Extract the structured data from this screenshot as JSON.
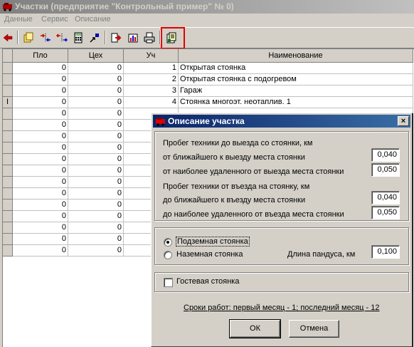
{
  "window": {
    "title": "Участки (предприятие \"Контрольный пример\" № 0)"
  },
  "menu": [
    "Данные",
    "Сервис",
    "Описание"
  ],
  "toolbar": {
    "buttons": [
      "back-arrow-icon",
      "copy-icon",
      "move-in-icon",
      "move-out-icon",
      "calculator-icon",
      "arrow-tool-icon",
      "export-icon",
      "chart-icon",
      "print-icon",
      "describe-icon"
    ]
  },
  "grid": {
    "columns": [
      "Пло",
      "Цех",
      "Уч",
      "Наименование"
    ],
    "rows": [
      [
        "0",
        "0",
        "1",
        "Открытая стоянка"
      ],
      [
        "0",
        "0",
        "2",
        "Открытая стоянка с подогревом"
      ],
      [
        "0",
        "0",
        "3",
        "Гараж"
      ],
      [
        "0",
        "0",
        "4",
        "Стоянка многоэт. неотаплив. 1"
      ],
      [
        "0",
        "0",
        "",
        ""
      ],
      [
        "0",
        "0",
        "",
        ""
      ],
      [
        "0",
        "0",
        "",
        ""
      ],
      [
        "0",
        "0",
        "",
        ""
      ],
      [
        "0",
        "0",
        "",
        ""
      ],
      [
        "0",
        "0",
        "",
        ""
      ],
      [
        "0",
        "0",
        "",
        ""
      ],
      [
        "0",
        "0",
        "",
        ""
      ],
      [
        "0",
        "0",
        "",
        ""
      ],
      [
        "0",
        "0",
        "",
        ""
      ],
      [
        "0",
        "0",
        "",
        ""
      ],
      [
        "0",
        "0",
        "",
        ""
      ],
      [
        "0",
        "0",
        "",
        ""
      ]
    ],
    "current_row_marker": "I"
  },
  "dialog": {
    "title": "Описание участка",
    "close_label": "×",
    "exit_group": {
      "heading": "Пробег техники до выезда со стоянки, км",
      "nearest_label": "от ближайшего к выезду места стоянки",
      "nearest_value": "0,040",
      "farthest_label": "от наиболее удаленного от выезда места стоянки",
      "farthest_value": "0,050"
    },
    "entry_group": {
      "heading": "Пробег техники от въезда на стоянку, км",
      "nearest_label": "до ближайшего к въезду места стоянки",
      "nearest_value": "0,040",
      "farthest_label": "до наиболее удаленного от въезда места стоянки",
      "farthest_value": "0,050"
    },
    "parking_type": {
      "underground_label": "Подземная стоянка",
      "ground_label": "Наземная стоянка",
      "selected": "underground",
      "ramp_label": "Длина пандуса, км",
      "ramp_value": "0,100"
    },
    "guest": {
      "label": "Гостевая стоянка",
      "checked": false
    },
    "schedule_link": "Сроки работ: первый месяц - 1; последний месяц - 12",
    "ok_label": "ОК",
    "cancel_label": "Отмена"
  },
  "colors": {
    "highlight": "#e00000",
    "dialog_title": "#0a246a",
    "inactive_title": "#808080"
  }
}
